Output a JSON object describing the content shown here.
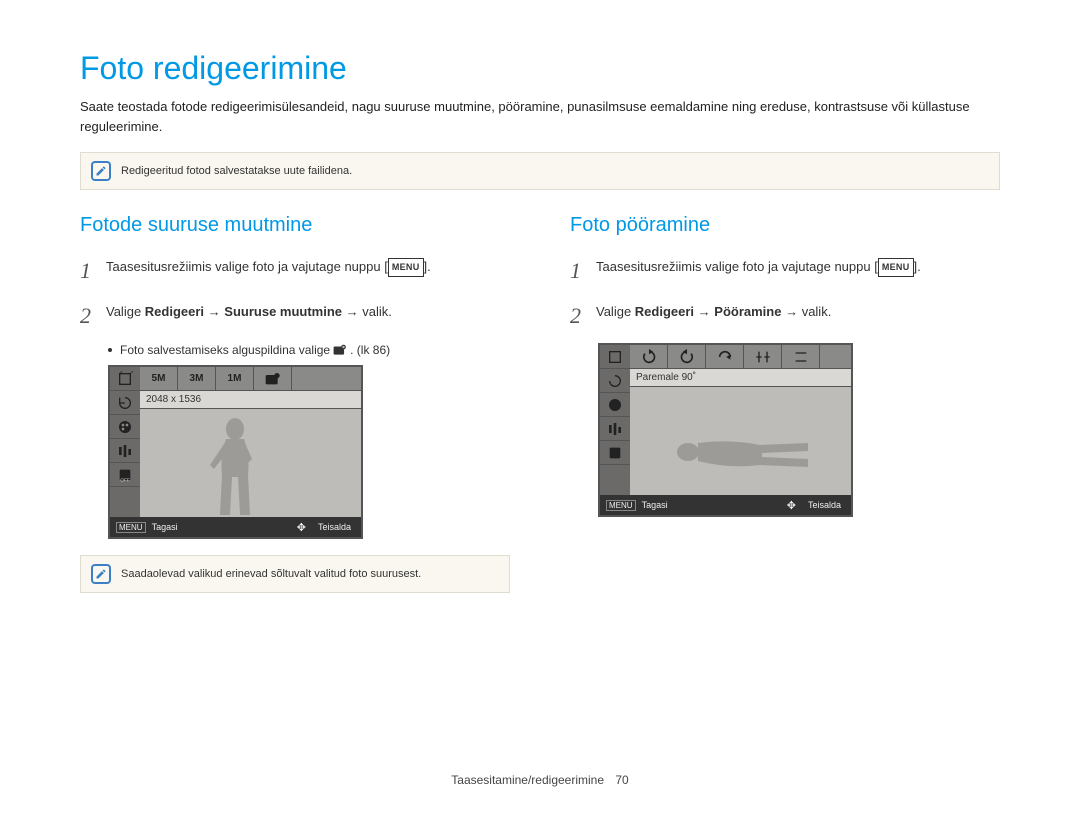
{
  "page_title": "Foto redigeerimine",
  "intro": "Saate teostada fotode redigeerimisülesandeid, nagu suuruse muutmine, pööramine, punasilmsuse eemaldamine ning ereduse, kontrastsuse või küllastuse reguleerimine.",
  "note1": "Redigeeritud fotod salvestatakse uute failidena.",
  "left": {
    "heading": "Fotode suuruse muutmine",
    "step1_a": "Taasesitusrežiimis valige foto ja vajutage nuppu [",
    "step1_b": "].",
    "step2_a": "Valige ",
    "step2_bold1": "Redigeeri",
    "step2_arrow": " → ",
    "step2_bold2": "Suuruse muutmine",
    "step2_c": " → valik.",
    "bullet_a": "Foto salvestamiseks alguspildina valige ",
    "bullet_b": ". (lk 86)",
    "cam_label": "2048 x 1536",
    "cam_back": "Tagasi",
    "cam_move": "Teisalda",
    "tabs": [
      "5M",
      "3M",
      "1M"
    ],
    "note2": "Saadaolevad valikud erinevad sõltuvalt valitud foto suurusest."
  },
  "right": {
    "heading": "Foto pööramine",
    "step1_a": "Taasesitusrežiimis valige foto ja vajutage nuppu [",
    "step1_b": "].",
    "step2_a": "Valige ",
    "step2_bold1": "Redigeeri",
    "step2_arrow": " → ",
    "step2_bold2": "Pööramine",
    "step2_c": " → valik.",
    "cam_label": "Paremale 90˚",
    "cam_back": "Tagasi",
    "cam_move": "Teisalda"
  },
  "menu_label": "MENU",
  "footer_section": "Taasesitamine/redigeerimine",
  "footer_page": "70"
}
